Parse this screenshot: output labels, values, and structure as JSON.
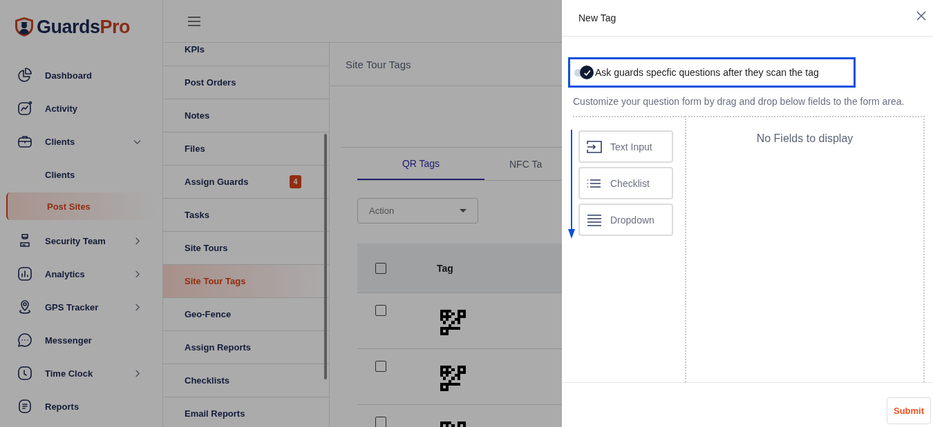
{
  "logo": {
    "parts": [
      "Guards",
      "Pro"
    ]
  },
  "sidebar": {
    "items": [
      {
        "label": "Dashboard",
        "selected": false
      },
      {
        "label": "Activity",
        "selected": false
      },
      {
        "label": "Clients",
        "selected": false,
        "expanded": true,
        "children": [
          {
            "label": "Clients",
            "selected": false
          },
          {
            "label": "Post Sites",
            "selected": true
          }
        ]
      },
      {
        "label": "Security Team",
        "selected": false,
        "expanded": false
      },
      {
        "label": "Analytics",
        "selected": false,
        "expanded": false
      },
      {
        "label": "GPS Tracker",
        "selected": false,
        "expanded": false
      },
      {
        "label": "Messenger",
        "selected": false
      },
      {
        "label": "Time Clock",
        "selected": false,
        "expanded": false
      },
      {
        "label": "Reports",
        "selected": false
      }
    ]
  },
  "submenu": {
    "items": [
      {
        "label": "KPIs",
        "selected": false
      },
      {
        "label": "Post Orders",
        "selected": false
      },
      {
        "label": "Notes",
        "selected": false
      },
      {
        "label": "Files",
        "selected": false
      },
      {
        "label": "Assign Guards",
        "selected": false,
        "badge": "4"
      },
      {
        "label": "Tasks",
        "selected": false
      },
      {
        "label": "Site Tours",
        "selected": false
      },
      {
        "label": "Site Tour Tags",
        "selected": true
      },
      {
        "label": "Geo-Fence",
        "selected": false
      },
      {
        "label": "Assign Reports",
        "selected": false
      },
      {
        "label": "Checklists",
        "selected": false
      },
      {
        "label": "Email Reports",
        "selected": false
      }
    ]
  },
  "content": {
    "title": "Site Tour Tags",
    "tabs": [
      {
        "label": "QR Tags",
        "selected": true
      },
      {
        "label": "NFC Ta",
        "selected": false
      }
    ],
    "action_select": {
      "placeholder": "Action"
    },
    "table": {
      "columns": [
        "Tag"
      ],
      "header_checked": false,
      "rows": [
        {
          "checked": false
        },
        {
          "checked": false
        },
        {
          "checked": false
        }
      ]
    }
  },
  "drawer": {
    "title": "New Tag",
    "toggle": {
      "on": true,
      "label": "Ask guards specfic questions after they scan the tag",
      "highlighted": true
    },
    "description": "Customize your question form by drag and drop below fields to the form area.",
    "fields": [
      {
        "kind": "text_input",
        "label": "Text Input"
      },
      {
        "kind": "checklist",
        "label": "Checklist"
      },
      {
        "kind": "dropdown",
        "label": "Dropdown"
      }
    ],
    "drag_arrow": true,
    "empty_text": "No Fields to display",
    "submit": "Submit"
  }
}
